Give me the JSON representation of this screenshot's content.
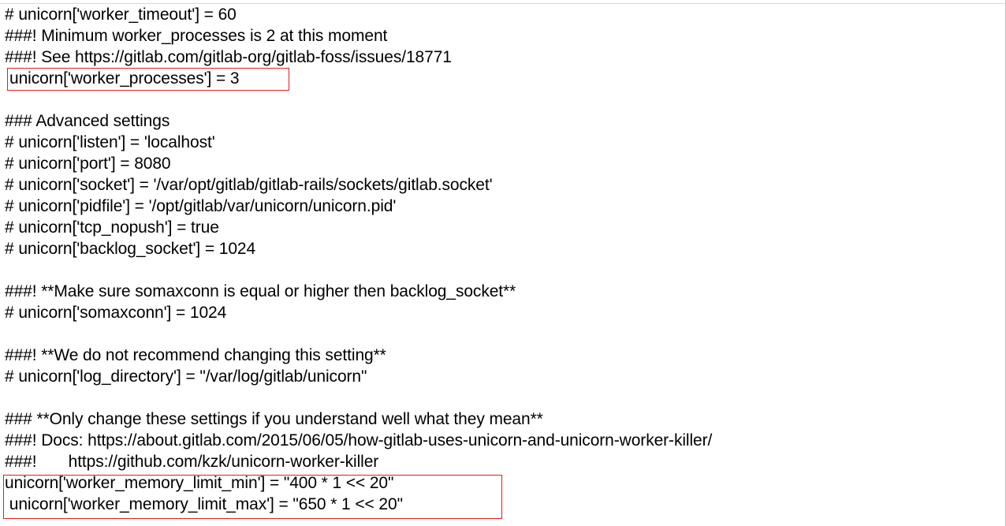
{
  "document": {
    "lines": [
      "# unicorn['worker_timeout'] = 60",
      "###! Minimum worker_processes is 2 at this moment",
      "###! See https://gitlab.com/gitlab-org/gitlab-foss/issues/18771",
      "unicorn['worker_processes'] = 3",
      "",
      "### Advanced settings",
      "# unicorn['listen'] = 'localhost'",
      "# unicorn['port'] = 8080",
      "# unicorn['socket'] = '/var/opt/gitlab/gitlab-rails/sockets/gitlab.socket'",
      "# unicorn['pidfile'] = '/opt/gitlab/var/unicorn/unicorn.pid'",
      "# unicorn['tcp_nopush'] = true",
      "# unicorn['backlog_socket'] = 1024",
      "",
      "###! **Make sure somaxconn is equal or higher then backlog_socket**",
      "# unicorn['somaxconn'] = 1024",
      "",
      "###! **We do not recommend changing this setting**",
      "# unicorn['log_directory'] = \"/var/log/gitlab/unicorn\"",
      "",
      "### **Only change these settings if you understand well what they mean**",
      "###! Docs: https://about.gitlab.com/2015/06/05/how-gitlab-uses-unicorn-and-unicorn-worker-killer/",
      "###!       https://github.com/kzk/unicorn-worker-killer",
      "unicorn['worker_memory_limit_min'] = \"400 * 1 << 20\"",
      " unicorn['worker_memory_limit_max'] = \"650 * 1 << 20\""
    ]
  },
  "highlights": [
    {
      "name": "worker-processes-highlight",
      "color": "#e02020"
    },
    {
      "name": "memory-limit-highlight",
      "color": "#e02020"
    }
  ]
}
